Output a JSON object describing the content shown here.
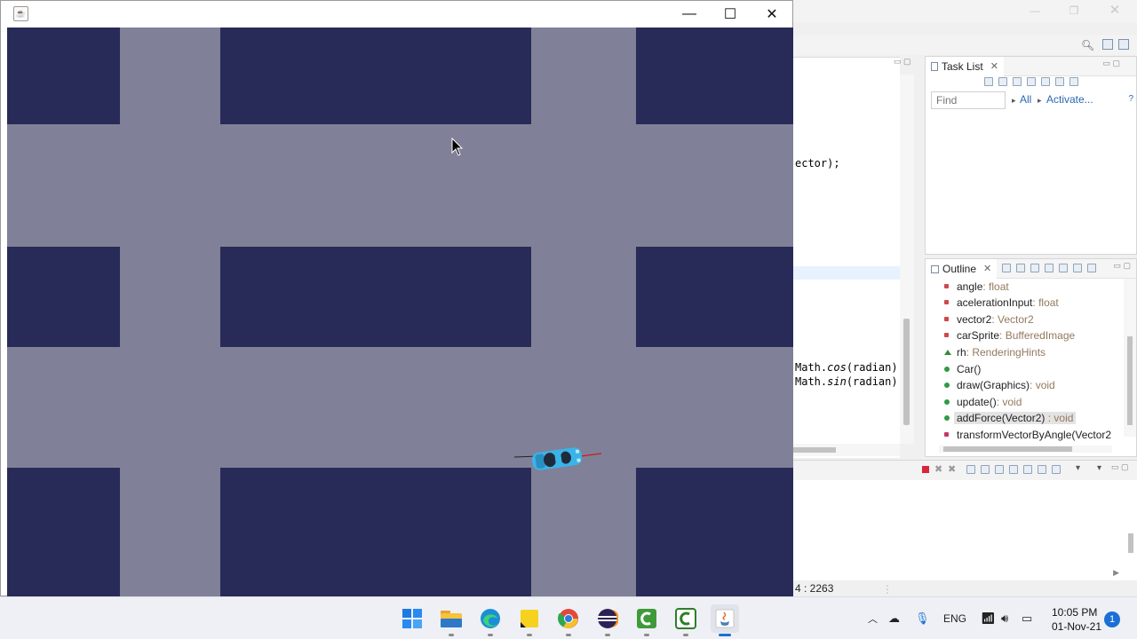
{
  "ide": {
    "editor_lines": [
      {
        "text": "ector);",
        "top": 0
      },
      {
        "pre": "Math.",
        "fn": "cos",
        "post": "(radian)"
      },
      {
        "pre": "Math.",
        "fn": "sin",
        "post": "(radian)"
      }
    ],
    "task_list": {
      "tab_label": "Task List",
      "find_placeholder": "Find",
      "all_label": "All",
      "activate_label": "Activate..."
    },
    "outline": {
      "tab_label": "Outline",
      "items": [
        {
          "name": "angle",
          "type": " : float",
          "color": "#d04848"
        },
        {
          "name": "acelerationInput",
          "type": " : float",
          "color": "#d04848"
        },
        {
          "name": "vector2",
          "type": " : Vector2",
          "color": "#d04848"
        },
        {
          "name": "carSprite",
          "type": " : BufferedImage",
          "color": "#d04848"
        },
        {
          "name": "rh",
          "type": " : RenderingHints",
          "color": "#3a8a3a"
        },
        {
          "name": "Car()",
          "type": "",
          "color": "#2f9a48"
        },
        {
          "name": "draw(Graphics)",
          "type": " : void",
          "color": "#2f9a48"
        },
        {
          "name": "update()",
          "type": " : void",
          "color": "#2f9a48"
        },
        {
          "name": "addForce(Vector2)",
          "type": " : void",
          "color": "#2f9a48"
        },
        {
          "name": "transformVectorByAngle(Vector2",
          "type": "",
          "color": "#c8366a"
        }
      ]
    },
    "status_position": "4 : 2263"
  },
  "game": {
    "road_color": "#808198",
    "block_color": "#282b57",
    "car_color": "#3ab4e8"
  },
  "taskbar": {
    "apps": [
      "start-icon",
      "file-explorer-icon",
      "edge-icon",
      "sticky-notes-icon",
      "chrome-icon",
      "eclipse-icon",
      "camtasia-icon",
      "camtasia-recorder-icon",
      "java-icon"
    ],
    "language": "ENG",
    "time": "10:05 PM",
    "date": "01-Nov-21",
    "notification_count": "1"
  }
}
